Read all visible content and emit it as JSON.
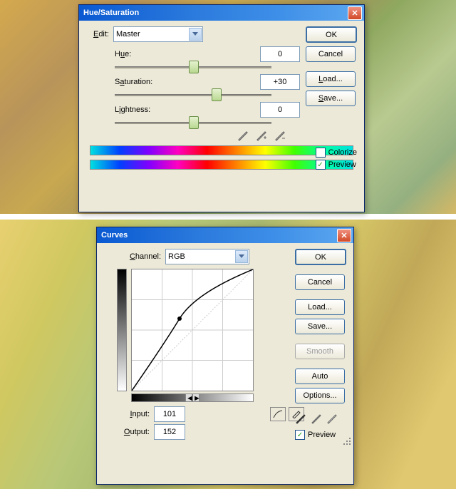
{
  "hue_sat": {
    "title": "Hue/Saturation",
    "edit_label": "Edit:",
    "edit_value": "Master",
    "hue_label": "Hue:",
    "hue_value": "0",
    "sat_label": "Saturation:",
    "sat_value": "+30",
    "light_label": "Lightness:",
    "light_value": "0",
    "ok": "OK",
    "cancel": "Cancel",
    "load": "Load...",
    "save": "Save...",
    "colorize": "Colorize",
    "colorize_checked": false,
    "preview": "Preview",
    "preview_checked": true
  },
  "curves": {
    "title": "Curves",
    "channel_label": "Channel:",
    "channel_value": "RGB",
    "input_label": "Input:",
    "input_value": "101",
    "output_label": "Output:",
    "output_value": "152",
    "ok": "OK",
    "cancel": "Cancel",
    "load": "Load...",
    "save": "Save...",
    "smooth": "Smooth",
    "auto": "Auto",
    "options": "Options...",
    "preview": "Preview",
    "preview_checked": true
  },
  "chart_data": {
    "type": "line",
    "title": "Curves adjustment",
    "xlabel": "Input",
    "ylabel": "Output",
    "xlim": [
      0,
      255
    ],
    "ylim": [
      0,
      255
    ],
    "series": [
      {
        "name": "RGB curve",
        "points": [
          [
            0,
            0
          ],
          [
            101,
            152
          ],
          [
            255,
            255
          ]
        ]
      }
    ]
  }
}
